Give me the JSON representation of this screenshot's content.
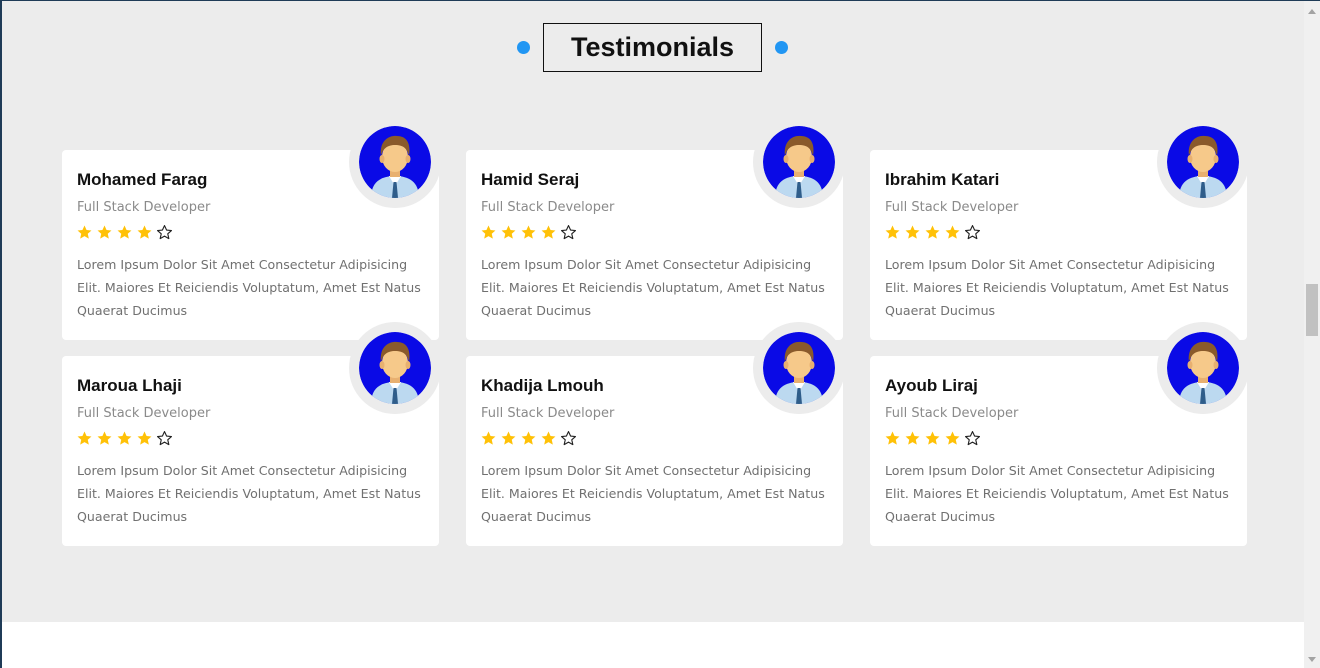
{
  "section": {
    "title": "Testimonials",
    "accent_color": "#2196f3",
    "background": "#ececec"
  },
  "star_color": "#ffc107",
  "avatar_icon": "user-avatar-icon",
  "testimonials": [
    {
      "name": "Mohamed Farag",
      "role": "Full Stack Developer",
      "rating": 4,
      "max_rating": 5,
      "text": "Lorem Ipsum Dolor Sit Amet Consectetur Adipisicing Elit. Maiores Et Reiciendis Voluptatum, Amet Est Natus Quaerat Ducimus"
    },
    {
      "name": "Hamid Seraj",
      "role": "Full Stack Developer",
      "rating": 4,
      "max_rating": 5,
      "text": "Lorem Ipsum Dolor Sit Amet Consectetur Adipisicing Elit. Maiores Et Reiciendis Voluptatum, Amet Est Natus Quaerat Ducimus"
    },
    {
      "name": "Ibrahim Katari",
      "role": "Full Stack Developer",
      "rating": 4,
      "max_rating": 5,
      "text": "Lorem Ipsum Dolor Sit Amet Consectetur Adipisicing Elit. Maiores Et Reiciendis Voluptatum, Amet Est Natus Quaerat Ducimus"
    },
    {
      "name": "Maroua Lhaji",
      "role": "Full Stack Developer",
      "rating": 4,
      "max_rating": 5,
      "text": "Lorem Ipsum Dolor Sit Amet Consectetur Adipisicing Elit. Maiores Et Reiciendis Voluptatum, Amet Est Natus Quaerat Ducimus"
    },
    {
      "name": "Khadija Lmouh",
      "role": "Full Stack Developer",
      "rating": 4,
      "max_rating": 5,
      "text": "Lorem Ipsum Dolor Sit Amet Consectetur Adipisicing Elit. Maiores Et Reiciendis Voluptatum, Amet Est Natus Quaerat Ducimus"
    },
    {
      "name": "Ayoub Liraj",
      "role": "Full Stack Developer",
      "rating": 4,
      "max_rating": 5,
      "text": "Lorem Ipsum Dolor Sit Amet Consectetur Adipisicing Elit. Maiores Et Reiciendis Voluptatum, Amet Est Natus Quaerat Ducimus"
    }
  ],
  "scrollbar": {
    "position": 0.45
  }
}
